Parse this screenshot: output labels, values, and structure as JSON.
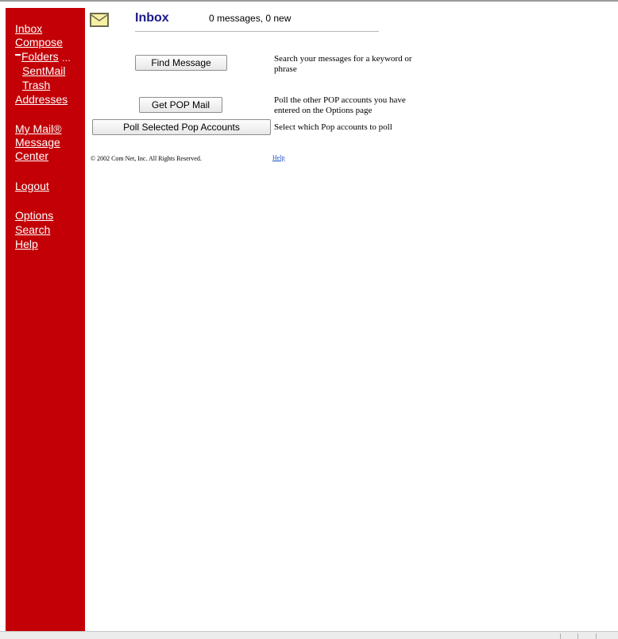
{
  "sidebar": {
    "inbox": "Inbox",
    "compose": "Compose",
    "folders": "Folders",
    "folders_more": "...",
    "sent_mail": "SentMail",
    "trash": "Trash",
    "addresses": "Addresses",
    "my_mail_line1": "My Mail®",
    "my_mail_line2": "Message",
    "my_mail_line3": "Center",
    "logout": "Logout",
    "options": "Options",
    "search": "Search",
    "help": "Help"
  },
  "header": {
    "title": "Inbox",
    "message_count": "0 messages, 0 new",
    "icon": "envelope-icon"
  },
  "actions": {
    "find_message": {
      "label": "Find Message",
      "description_line1": "Search your messages for a keyword or",
      "description_line2": "phrase"
    },
    "get_pop_mail": {
      "label": "Get POP Mail",
      "description_line1": "Poll the other POP accounts you have",
      "description_line2": "entered on the Options page"
    },
    "poll_selected": {
      "label": "Poll Selected Pop Accounts",
      "description": "Select which Pop accounts to poll"
    }
  },
  "footer": {
    "copyright": "© 2002 Com Net, Inc. All Rights Reserved.",
    "help": "Help"
  },
  "colors": {
    "sidebar_bg": "#c20006",
    "title": "#1a1a8a",
    "link": "#1a4ec4"
  }
}
